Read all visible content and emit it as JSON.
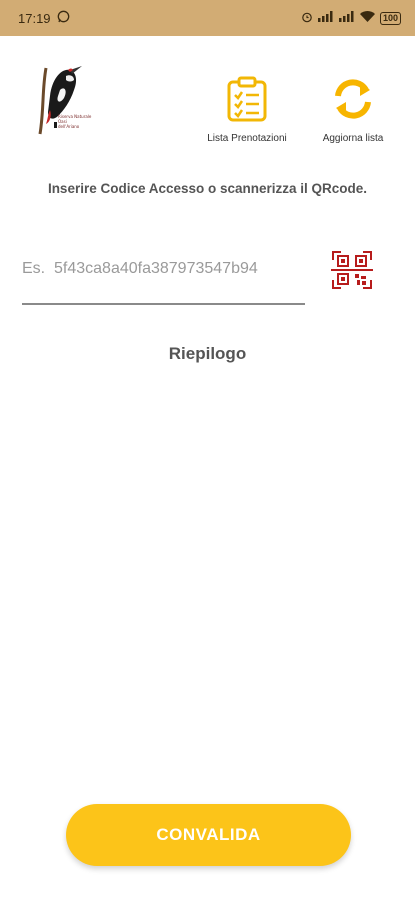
{
  "status_bar": {
    "time": "17:19",
    "battery": "100",
    "icons": [
      "whatsapp-icon",
      "alarm-icon",
      "signal-icon",
      "signal-icon",
      "wifi-icon",
      "battery-icon"
    ]
  },
  "header": {
    "logo_lines": [
      "Riserva Naturale",
      "Oasi",
      "dell'Ariano"
    ],
    "actions": [
      {
        "label": "Lista Prenotazioni",
        "icon": "clipboard-list-icon"
      },
      {
        "label": "Aggiorna lista",
        "icon": "refresh-icon"
      }
    ]
  },
  "instruction": "Inserire Codice Accesso o scannerizza il QRcode.",
  "code_field": {
    "value": "",
    "placeholder": "Es.  5f43ca8a40fa387973547b94"
  },
  "qr_button": {
    "icon": "qr-scan-icon"
  },
  "summary_title": "Riepilogo",
  "validate_button": {
    "label": "CONVALIDA"
  },
  "colors": {
    "status_bar": "#d2ac74",
    "accent": "#fcc419",
    "qr_icon": "#b71c1c"
  }
}
